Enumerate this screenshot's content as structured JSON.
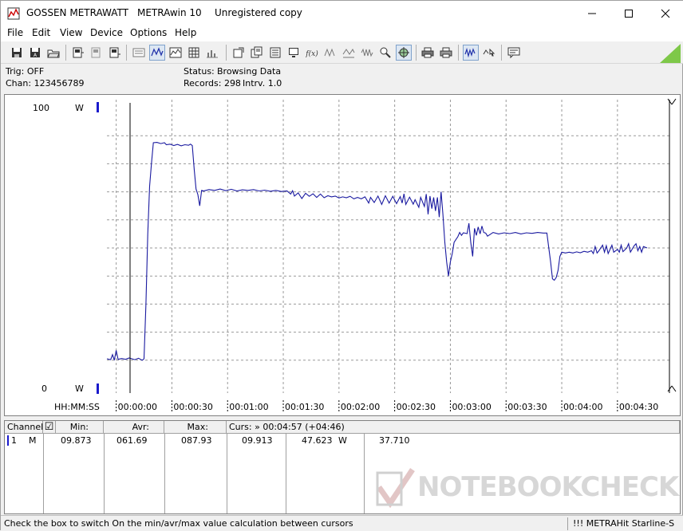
{
  "titlebar": {
    "brand": "GOSSEN METRAWATT",
    "app": "METRAwin 10",
    "license": "Unregistered copy",
    "minimize_icon": "minimize-icon",
    "maximize_icon": "maximize-icon",
    "close_icon": "close-icon"
  },
  "menu": [
    "File",
    "Edit",
    "View",
    "Device",
    "Options",
    "Help"
  ],
  "toolbar": {
    "icons": [
      "save-icon",
      "save-all-icon",
      "open-folder-icon",
      "device-icon",
      "device-gray-icon",
      "device-io-icon",
      "list-icon",
      "waveform-icon",
      "table-icon",
      "bargraph-icon",
      "export-icon",
      "copy-icon",
      "settings-list-icon",
      "monitor-icon",
      "fx-icon",
      "wave-a-icon",
      "wave-b-icon",
      "wave-c-icon",
      "filter-icon",
      "cursor-icon",
      "print-icon",
      "print-preview-icon",
      "zoom-wave-icon",
      "zoom-cursor-icon",
      "comment-icon"
    ]
  },
  "info": {
    "trig": "Trig: OFF",
    "chan": "Chan:  123456789",
    "status_label": "Status:",
    "status_value": "Browsing Data",
    "records": "Records: 298",
    "interval": "Intrv. 1.0"
  },
  "chart_data": {
    "type": "line",
    "y_unit": "W",
    "ylim": [
      0,
      100
    ],
    "y_top_label": "100",
    "y_bottom_label": "0",
    "y_unit_top": "W",
    "y_unit_bottom": "W",
    "x_axis_label": "HH:MM:SS",
    "x_ticks": [
      "00:00:00",
      "00:00:30",
      "00:01:00",
      "00:01:30",
      "00:02:00",
      "00:02:30",
      "00:03:00",
      "00:03:30",
      "00:04:00",
      "00:04:30"
    ],
    "xlim_seconds": [
      -5,
      298
    ],
    "grid": true,
    "line_color": "#1a1aa0",
    "series": [
      {
        "points": [
          [
            -5,
            10.5
          ],
          [
            -3,
            10.2
          ],
          [
            -2,
            12
          ],
          [
            -1,
            10.0
          ],
          [
            0,
            13.5
          ],
          [
            1,
            10.3
          ],
          [
            3,
            10.6
          ],
          [
            5,
            10.3
          ],
          [
            7,
            10.8
          ],
          [
            10,
            10.2
          ],
          [
            12,
            10.7
          ],
          [
            14,
            10.0
          ],
          [
            15,
            10.5
          ],
          [
            16,
            30
          ],
          [
            17,
            55
          ],
          [
            18,
            72
          ],
          [
            19,
            80
          ],
          [
            20,
            87.5
          ],
          [
            22,
            87.6
          ],
          [
            24,
            87.2
          ],
          [
            26,
            87.5
          ],
          [
            27,
            86.8
          ],
          [
            29,
            87.0
          ],
          [
            31,
            86.5
          ],
          [
            33,
            86.9
          ],
          [
            35,
            86.4
          ],
          [
            37,
            86.8
          ],
          [
            39,
            86.6
          ],
          [
            40,
            87.0
          ],
          [
            41,
            86.5
          ],
          [
            42,
            78
          ],
          [
            43,
            71
          ],
          [
            44,
            69
          ],
          [
            45,
            65
          ],
          [
            46,
            70.5
          ],
          [
            47,
            70.3
          ],
          [
            50,
            70.8
          ],
          [
            53,
            70.5
          ],
          [
            56,
            71.0
          ],
          [
            59,
            70.4
          ],
          [
            62,
            70.9
          ],
          [
            65,
            70.3
          ],
          [
            68,
            70.7
          ],
          [
            71,
            70.5
          ],
          [
            74,
            70.8
          ],
          [
            77,
            70.3
          ],
          [
            80,
            70.6
          ],
          [
            83,
            70.2
          ],
          [
            86,
            70.5
          ],
          [
            89,
            70.1
          ],
          [
            92,
            70.3
          ],
          [
            94,
            69.2
          ],
          [
            95,
            70.4
          ],
          [
            96,
            68.5
          ],
          [
            98,
            69.6
          ],
          [
            100,
            67.6
          ],
          [
            102,
            69.5
          ],
          [
            104,
            68.4
          ],
          [
            106,
            69.3
          ],
          [
            108,
            68.0
          ],
          [
            110,
            69.2
          ],
          [
            112,
            67.9
          ],
          [
            114,
            68.6
          ],
          [
            116,
            68.2
          ],
          [
            118,
            68.5
          ],
          [
            120,
            67.8
          ],
          [
            122,
            68.2
          ],
          [
            124,
            67.9
          ],
          [
            126,
            68.4
          ],
          [
            128,
            67.5
          ],
          [
            130,
            68.0
          ],
          [
            132,
            67.5
          ],
          [
            134,
            68.2
          ],
          [
            136,
            66.0
          ],
          [
            137,
            68.0
          ],
          [
            139,
            66.2
          ],
          [
            141,
            68.5
          ],
          [
            143,
            65.5
          ],
          [
            145,
            68.6
          ],
          [
            147,
            66.0
          ],
          [
            149,
            68.4
          ],
          [
            151,
            65.8
          ],
          [
            153,
            68.3
          ],
          [
            154,
            66.0
          ],
          [
            155,
            69.3
          ],
          [
            156,
            65.5
          ],
          [
            158,
            68.1
          ],
          [
            160,
            65.6
          ],
          [
            161,
            67.2
          ],
          [
            163,
            64.5
          ],
          [
            164,
            68.0
          ],
          [
            166,
            64.8
          ],
          [
            167,
            69.2
          ],
          [
            168,
            62.0
          ],
          [
            169,
            68.5
          ],
          [
            170,
            64.0
          ],
          [
            171,
            68.0
          ],
          [
            172,
            63.2
          ],
          [
            173,
            68.0
          ],
          [
            174,
            61.0
          ],
          [
            175,
            70.0
          ],
          [
            176,
            62.0
          ],
          [
            177,
            52
          ],
          [
            178,
            45
          ],
          [
            179,
            40.0
          ],
          [
            180,
            45
          ],
          [
            181,
            48
          ],
          [
            182,
            52
          ],
          [
            183,
            53
          ],
          [
            184,
            54
          ],
          [
            185,
            55.5
          ],
          [
            186,
            54.5
          ],
          [
            187,
            55.4
          ],
          [
            189,
            55.1
          ],
          [
            190,
            58.8
          ],
          [
            191,
            52.0
          ],
          [
            192,
            47.0
          ],
          [
            193,
            57.0
          ],
          [
            194,
            54.5
          ],
          [
            195,
            57.5
          ],
          [
            196,
            55.0
          ],
          [
            197,
            57.8
          ],
          [
            198,
            55.5
          ],
          [
            199,
            55.3
          ],
          [
            200,
            54.2
          ],
          [
            203,
            55.5
          ],
          [
            206,
            55.0
          ],
          [
            209,
            55.4
          ],
          [
            212,
            55.1
          ],
          [
            215,
            55.5
          ],
          [
            218,
            55.0
          ],
          [
            221,
            55.4
          ],
          [
            224,
            55.2
          ],
          [
            227,
            55.5
          ],
          [
            230,
            55.3
          ],
          [
            232,
            55.3
          ],
          [
            233,
            50
          ],
          [
            234,
            45
          ],
          [
            235,
            39
          ],
          [
            236,
            38.5
          ],
          [
            237,
            39.5
          ],
          [
            238,
            42
          ],
          [
            239,
            47
          ],
          [
            240,
            48.5
          ],
          [
            242,
            48.2
          ],
          [
            244,
            48.5
          ],
          [
            246,
            48.2
          ],
          [
            248,
            48.6
          ],
          [
            250,
            48.3
          ],
          [
            252,
            48.8
          ],
          [
            254,
            48.5
          ],
          [
            256,
            49.0
          ],
          [
            257,
            48.0
          ],
          [
            258,
            50.5
          ],
          [
            259,
            48.2
          ],
          [
            260,
            49.0
          ],
          [
            262,
            51.0
          ],
          [
            263,
            48.5
          ],
          [
            264,
            50.8
          ],
          [
            265,
            48.0
          ],
          [
            267,
            51.0
          ],
          [
            268,
            48.5
          ],
          [
            270,
            49.5
          ],
          [
            271,
            48.5
          ],
          [
            272,
            51.0
          ],
          [
            273,
            48.7
          ],
          [
            275,
            50.0
          ],
          [
            276,
            51.5
          ],
          [
            277,
            48.5
          ],
          [
            279,
            50.8
          ],
          [
            280,
            51.5
          ],
          [
            281,
            49.0
          ],
          [
            282,
            50.5
          ],
          [
            283,
            48.5
          ],
          [
            284,
            50.5
          ],
          [
            286,
            50.0
          ]
        ]
      }
    ]
  },
  "table": {
    "headers": {
      "channel": "Channel:",
      "checkbox": "☑",
      "min": "Min:",
      "avr": "Avr:",
      "max": "Max:",
      "cursor": "Curs: » 00:04:57 (+04:46)"
    },
    "row": {
      "channel_num": "1",
      "channel_mode": "M",
      "min": "09.873",
      "avr": "061.69",
      "max": "087.93",
      "cursor_a": "09.913",
      "cursor_b": "47.623",
      "unit": "W",
      "cursor_c": "37.710"
    }
  },
  "statusbar": {
    "hint": "Check the box to switch On the min/avr/max value calculation between cursors",
    "device": "!!! METRAHit Starline-S"
  },
  "watermark": {
    "text": "NOTEBOOKCHECK"
  }
}
